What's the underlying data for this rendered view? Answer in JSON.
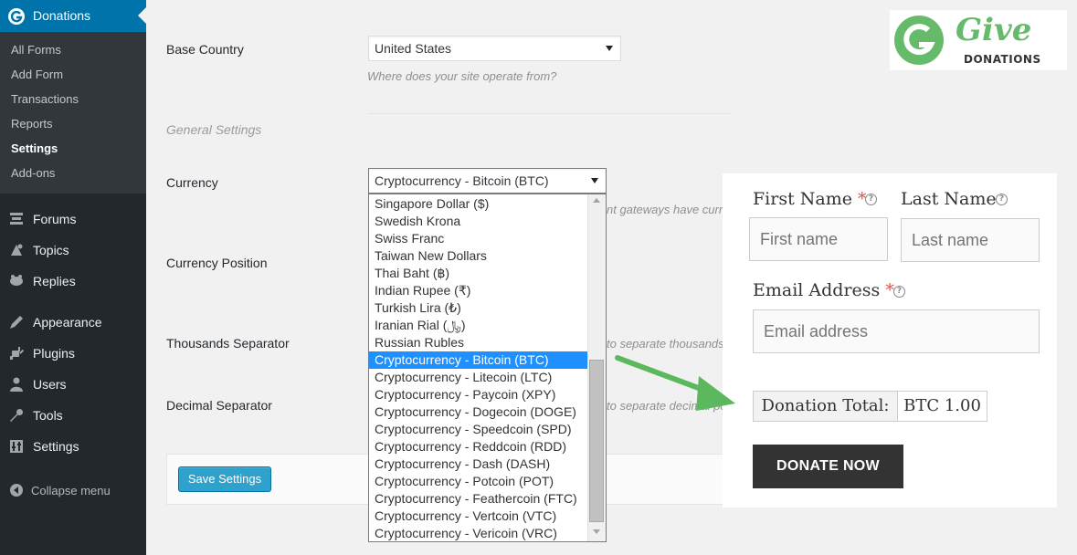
{
  "sidebar": {
    "current_menu": "Donations",
    "submenu": [
      "All Forms",
      "Add Form",
      "Transactions",
      "Reports",
      "Settings",
      "Add-ons"
    ],
    "active_submenu": "Settings",
    "items": [
      {
        "label": "Forums",
        "icon": "forums-icon"
      },
      {
        "label": "Topics",
        "icon": "topics-icon"
      },
      {
        "label": "Replies",
        "icon": "replies-icon"
      },
      {
        "label": "Appearance",
        "icon": "appearance-icon"
      },
      {
        "label": "Plugins",
        "icon": "plugins-icon"
      },
      {
        "label": "Users",
        "icon": "users-icon"
      },
      {
        "label": "Tools",
        "icon": "tools-icon"
      },
      {
        "label": "Settings",
        "icon": "settings-icon"
      }
    ],
    "collapse_label": "Collapse menu"
  },
  "settings": {
    "base_country_label": "Base Country",
    "base_country_value": "United States",
    "base_country_desc": "Where does your site operate from?",
    "general_settings_title": "General Settings",
    "currency_label": "Currency",
    "currency_value": "Cryptocurrency - Bitcoin (BTC)",
    "currency_desc_partial": "nt gateways have curre",
    "currency_position_label": "Currency Position",
    "thousands_label": "Thousands Separator",
    "thousands_desc_partial": "to separate thousands",
    "decimal_label": "Decimal Separator",
    "decimal_desc_partial": "to separate decimal poi",
    "save_button": "Save Settings"
  },
  "currency_options": [
    "Singapore Dollar ($)",
    "Swedish Krona",
    "Swiss Franc",
    "Taiwan New Dollars",
    "Thai Baht (฿)",
    "Indian Rupee (₹)",
    "Turkish Lira (₺)",
    "Iranian Rial (﷼)",
    "Russian Rubles",
    "Cryptocurrency - Bitcoin (BTC)",
    "Cryptocurrency - Litecoin (LTC)",
    "Cryptocurrency - Paycoin (XPY)",
    "Cryptocurrency - Dogecoin (DOGE)",
    "Cryptocurrency - Speedcoin (SPD)",
    "Cryptocurrency - Reddcoin (RDD)",
    "Cryptocurrency - Dash (DASH)",
    "Cryptocurrency - Potcoin (POT)",
    "Cryptocurrency - Feathercoin (FTC)",
    "Cryptocurrency - Vertcoin (VTC)",
    "Cryptocurrency - Vericoin (VRC)"
  ],
  "selected_option_index": 9,
  "donation_form": {
    "first_name_label": "First Name",
    "last_name_label": "Last Name",
    "email_label": "Email Address",
    "required_mark": "*",
    "help_glyph": "?",
    "first_name_placeholder": "First name",
    "last_name_placeholder": "Last name",
    "email_placeholder": "Email address",
    "total_label": "Donation Total:",
    "total_value": "BTC 1.00",
    "donate_button": "DONATE NOW"
  },
  "logo": {
    "wordmark": "Give",
    "subtitle": "DONATIONS",
    "brand_color": "#66bb6a"
  },
  "colors": {
    "sidebar_bg": "#23282d",
    "submenu_bg": "#32373c",
    "active_menu": "#0073aa",
    "selected_option": "#1e90ff",
    "arrow": "#5cb85c",
    "donate_button": "#333333"
  }
}
